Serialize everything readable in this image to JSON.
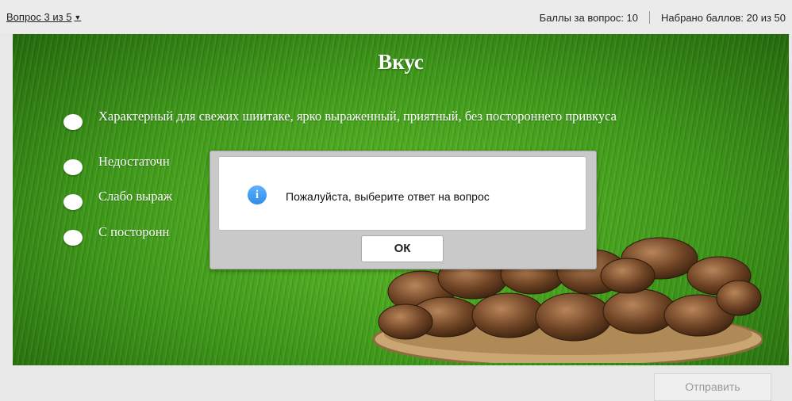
{
  "header": {
    "question_nav": "Вопрос 3 из 5",
    "points_per_question": "Баллы за вопрос: 10",
    "points_total": "Набрано баллов: 20 из 50"
  },
  "question": {
    "title": "Вкус",
    "options": [
      {
        "text": "Характерный для свежих шиитаке, ярко выраженный, приятный, без постороннего привкуса"
      },
      {
        "text": "Недостаточн"
      },
      {
        "text": "Слабо выраж"
      },
      {
        "text": "С посторонн"
      }
    ]
  },
  "dialog": {
    "message": "Пожалуйста, выберите ответ на вопрос",
    "ok_label": "ОК",
    "icon": "info-icon"
  },
  "footer": {
    "submit_label": "Отправить"
  },
  "colors": {
    "grass": "#3f9a1a",
    "info_blue": "#2c8be8"
  }
}
